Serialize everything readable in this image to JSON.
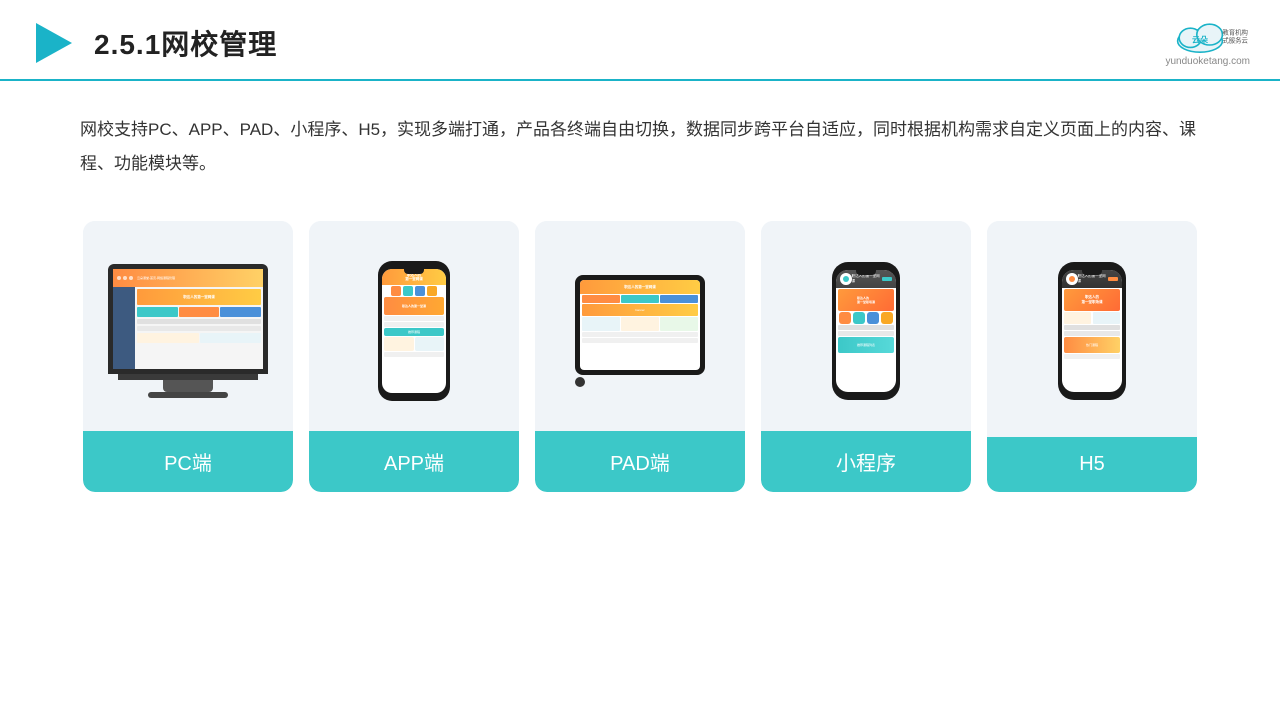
{
  "header": {
    "title": "2.5.1网校管理",
    "logo_url": "yunduoketang.com",
    "logo_slogan": "教育机构一站\n式服务云平台"
  },
  "description": {
    "text": "网校支持PC、APP、PAD、小程序、H5，实现多端打通，产品各终端自由切换，数据同步跨平台自适应，同时根据机构需求自定义页面上的内容、课程、功能模块等。"
  },
  "cards": [
    {
      "id": "pc",
      "label": "PC端"
    },
    {
      "id": "app",
      "label": "APP端"
    },
    {
      "id": "pad",
      "label": "PAD端"
    },
    {
      "id": "miniprogram",
      "label": "小程序"
    },
    {
      "id": "h5",
      "label": "H5"
    }
  ],
  "accent_color": "#3cc8c8"
}
